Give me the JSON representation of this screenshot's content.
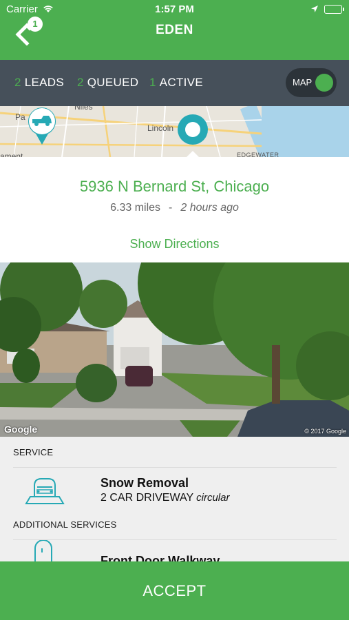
{
  "status_bar": {
    "carrier": "Carrier",
    "time": "1:57 PM"
  },
  "nav": {
    "title": "EDEN",
    "back_badge": "1"
  },
  "tabs": [
    {
      "count": "2",
      "label": "LEADS"
    },
    {
      "count": "2",
      "label": "QUEUED"
    },
    {
      "count": "1",
      "label": "ACTIVE"
    }
  ],
  "map_toggle": {
    "label": "MAP",
    "state": "on"
  },
  "map": {
    "labels": [
      "Pa",
      "Niles",
      "Lincoln",
      "ament",
      "EDGEWATER"
    ]
  },
  "lead": {
    "address": "5936 N Bernard St, Chicago",
    "distance": "6.33 miles",
    "separator": "-",
    "time_ago": "2 hours ago",
    "directions_label": "Show Directions"
  },
  "photo": {
    "logo": "Google",
    "copyright": "© 2017 Google"
  },
  "service": {
    "header": "SERVICE",
    "title": "Snow Removal",
    "detail": "2 CAR DRIVEWAY",
    "detail_extra": "circular",
    "icon": "car-driveway-icon"
  },
  "additional": {
    "header": "ADDITIONAL SERVICES",
    "title": "Front Door Walkway",
    "icon": "door-icon"
  },
  "accept_label": "ACCEPT",
  "colors": {
    "brand_green": "#4caf50",
    "tab_bar": "#46505a",
    "map_pin_teal": "#26a9b5"
  }
}
